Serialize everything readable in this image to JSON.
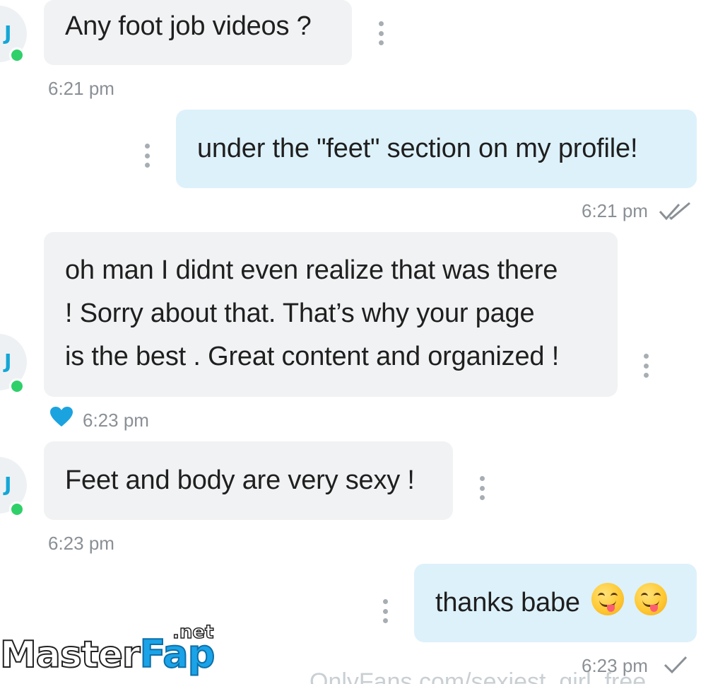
{
  "conversation": {
    "contact_initial": "J",
    "messages": [
      {
        "direction": "incoming",
        "text": "Any foot job videos ?",
        "time": "6:21 pm"
      },
      {
        "direction": "outgoing",
        "text": "under the \"feet\" section on my profile!",
        "time": "6:21 pm",
        "status": "read-double-check"
      },
      {
        "direction": "incoming",
        "lines": [
          "oh man I didnt even realize that was there",
          "! Sorry about that. That’s why your page",
          "is the best . Great content and organized !"
        ],
        "time": "6:23 pm",
        "liked": true
      },
      {
        "direction": "incoming",
        "text": "Feet and body are very sexy !",
        "time": "6:23 pm"
      },
      {
        "direction": "outgoing",
        "text": "thanks babe",
        "emoji": [
          "face-savoring-food",
          "face-savoring-food"
        ],
        "time": "6:23 pm",
        "status": "sent-single-check"
      }
    ]
  },
  "watermark": {
    "brand_part1": "Master",
    "brand_part2": "Fap",
    "brand_suffix": ".net",
    "footer_url": "OnlyFans.com/sexiest_girl_free"
  },
  "colors": {
    "incoming_bubble": "#f1f2f3",
    "outgoing_bubble": "#ddf1fb",
    "online_dot": "#2fd06a",
    "heart": "#1ba3e0",
    "timestamp": "#8a9095"
  }
}
